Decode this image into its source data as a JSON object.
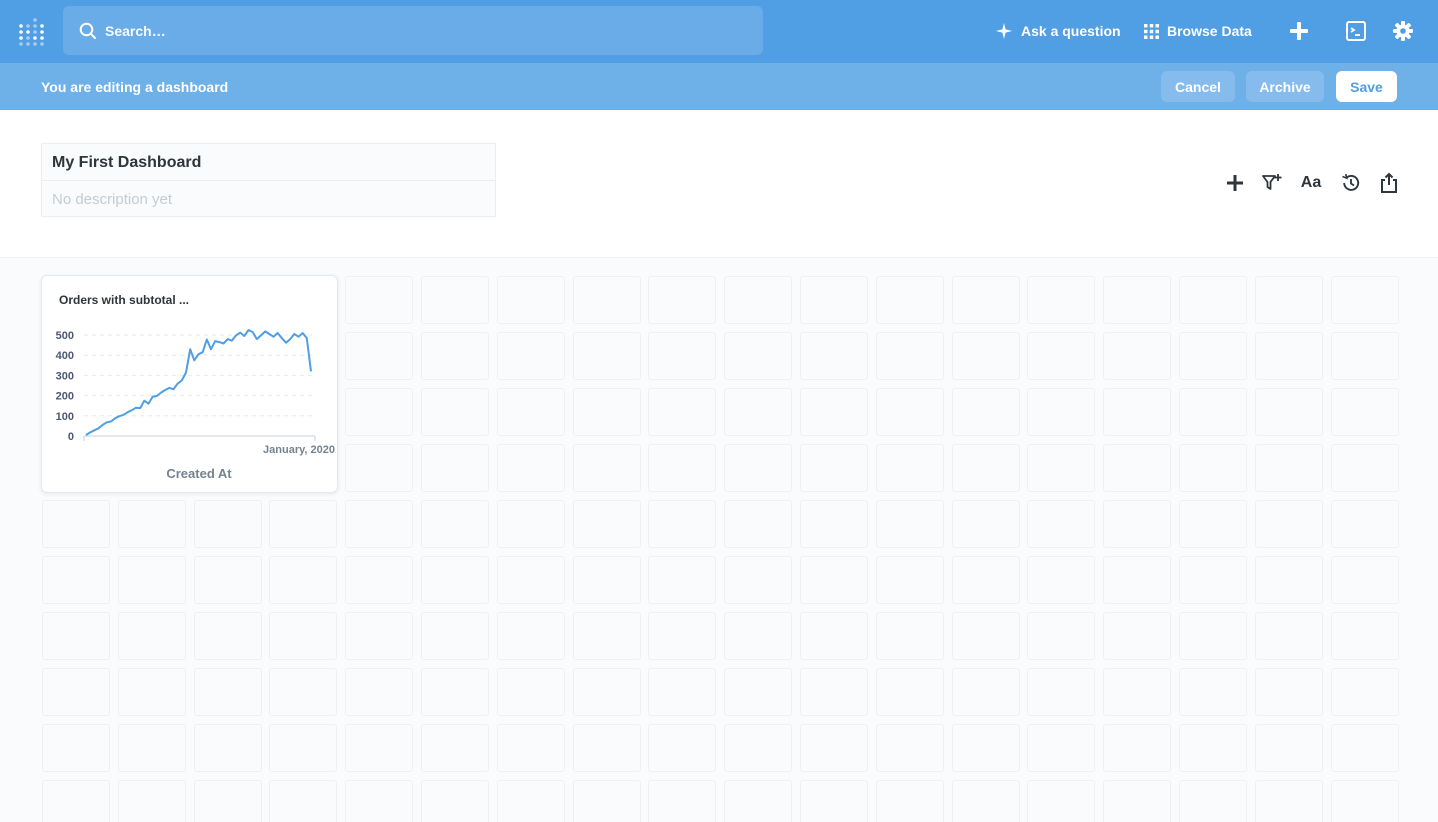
{
  "nav": {
    "search_placeholder": "Search…",
    "ask_question": "Ask a question",
    "browse_data": "Browse Data"
  },
  "edit_bar": {
    "message": "You are editing a dashboard",
    "cancel": "Cancel",
    "archive": "Archive",
    "save": "Save"
  },
  "dashboard": {
    "title": "My First Dashboard",
    "description_placeholder": "No description yet",
    "text_tool": "Aa"
  },
  "card": {
    "title": "Orders with subtotal ..."
  },
  "chart_data": {
    "type": "line",
    "title": "Orders with subtotal ...",
    "xlabel": "Created At",
    "ylabel": "",
    "x_tick_labels": [
      "January, 2020"
    ],
    "y_ticks": [
      0,
      100,
      200,
      300,
      400,
      500
    ],
    "ylim": [
      0,
      520
    ],
    "series": [
      {
        "color": "#509ee3",
        "values": [
          5,
          18,
          28,
          38,
          55,
          68,
          72,
          88,
          98,
          105,
          118,
          128,
          140,
          138,
          175,
          160,
          195,
          198,
          215,
          228,
          238,
          232,
          260,
          275,
          315,
          430,
          375,
          405,
          415,
          478,
          430,
          470,
          465,
          458,
          480,
          472,
          498,
          512,
          495,
          525,
          515,
          480,
          498,
          518,
          505,
          492,
          510,
          485,
          462,
          480,
          505,
          492,
          510,
          485,
          320
        ]
      }
    ],
    "grid": true
  },
  "colors": {
    "brand": "#509ee3",
    "edit_bar": "#6eb0e8"
  }
}
